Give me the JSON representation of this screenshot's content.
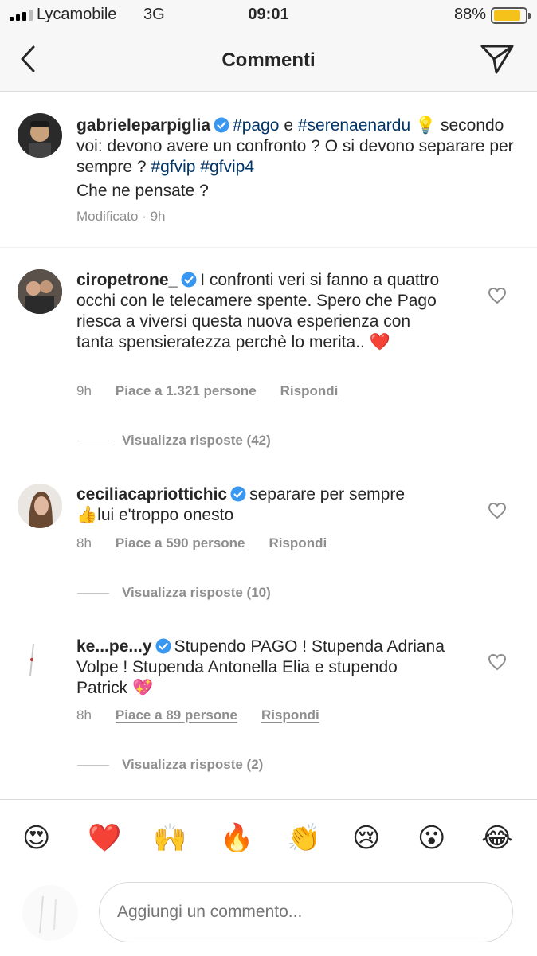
{
  "status_bar": {
    "carrier": "Lycamobile",
    "network": "3G",
    "time": "09:01",
    "battery": "88%",
    "battery_level": 0.88
  },
  "header": {
    "title": "Commenti",
    "back_icon": "chevron-left-icon",
    "send_icon": "paper-plane-icon"
  },
  "caption": {
    "username": "gabrieleparpiglia",
    "tag1": "#pago",
    "connector": "e",
    "tag2": "#serenaenardu",
    "text1": "secondo voi: devono avere un confronto ? O si devono separare per sempre ?",
    "tag3": "#gfvip",
    "tag4": "#gfvip4",
    "text2": "Che ne pensate ?",
    "meta": "Modificato · 9h"
  },
  "comments": [
    {
      "username": "ciropetrone_",
      "text": "I confronti veri si fanno a quattro occhi con le telecamere spente. Spero che Pago riesca a viversi questa nuova esperienza con tanta spensieratezza perchè lo merita..",
      "emoji": "❤️",
      "time": "9h",
      "likes": "Piace a 1.321 persone",
      "reply": "Rispondi",
      "view_replies": "Visualizza risposte (42)"
    },
    {
      "username": "ceciliacapriottichic",
      "text_pre": "separare per sempre",
      "emoji": "👍",
      "text_post": "lui e'troppo onesto",
      "time": "8h",
      "likes": "Piace a 590 persone",
      "reply": "Rispondi",
      "view_replies": "Visualizza risposte (10)"
    },
    {
      "username": "ke...pe...y",
      "text": "Stupendo PAGO ! Stupenda Adriana Volpe ! Stupenda Antonella Elia e stupendo Patrick",
      "emoji": "💖",
      "time": "8h",
      "likes": "Piace a 89 persone",
      "reply": "Rispondi",
      "view_replies": "Visualizza risposte (2)"
    }
  ],
  "emoji_bar": [
    "😍",
    "❤️",
    "🙌",
    "🔥",
    "👏",
    "😢",
    "😮",
    "😂"
  ],
  "composer": {
    "placeholder": "Aggiungi un commento..."
  },
  "colors": {
    "hashtag": "#003569",
    "verified": "#3897f0",
    "muted": "#8e8e8e",
    "header_bg": "#f7f7f7"
  }
}
